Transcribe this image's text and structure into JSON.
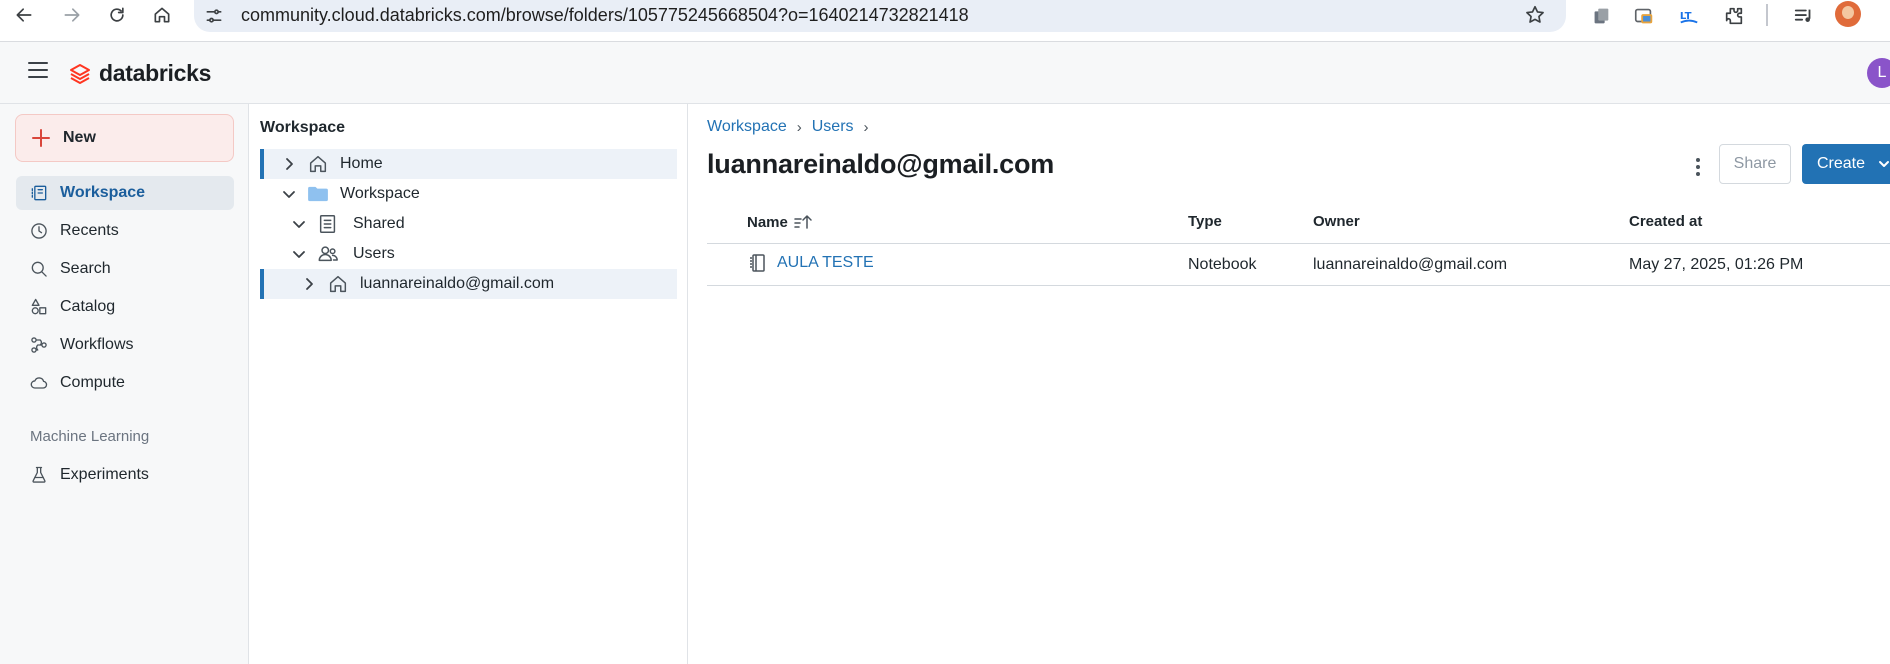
{
  "browser": {
    "url": "community.cloud.databricks.com/browse/folders/105775245668504?o=1640214732821418"
  },
  "app": {
    "brand": "databricks",
    "user_initial": "L"
  },
  "leftnav": {
    "new_label": "New",
    "items": [
      {
        "label": "Workspace",
        "icon": "workspace-icon",
        "active": true
      },
      {
        "label": "Recents",
        "icon": "clock-icon"
      },
      {
        "label": "Search",
        "icon": "search-icon"
      },
      {
        "label": "Catalog",
        "icon": "catalog-icon"
      },
      {
        "label": "Workflows",
        "icon": "workflows-icon"
      },
      {
        "label": "Compute",
        "icon": "cloud-icon"
      }
    ],
    "section_ml": "Machine Learning",
    "ml_items": [
      {
        "label": "Experiments",
        "icon": "flask-icon"
      }
    ]
  },
  "tree": {
    "title": "Workspace",
    "nodes": [
      {
        "label": "Home",
        "expanded": false,
        "selected": true
      },
      {
        "label": "Workspace",
        "expanded": true
      },
      {
        "label": "Shared",
        "expanded": true
      },
      {
        "label": "Users",
        "expanded": true
      },
      {
        "label": "luannareinaldo@gmail.com",
        "expanded": false,
        "selected": true
      }
    ]
  },
  "main": {
    "breadcrumb": [
      "Workspace",
      "Users"
    ],
    "title": "luannareinaldo@gmail.com",
    "share_label": "Share",
    "create_label": "Create",
    "columns": {
      "name": "Name",
      "type": "Type",
      "owner": "Owner",
      "created": "Created at"
    },
    "rows": [
      {
        "name": "AULA TESTE",
        "type": "Notebook",
        "owner": "luannareinaldo@gmail.com",
        "created": "May 27, 2025, 01:26 PM"
      }
    ]
  },
  "colors": {
    "accent": "#2272b4",
    "brand": "#ff3621",
    "new_button_bg": "#fbeceb"
  }
}
